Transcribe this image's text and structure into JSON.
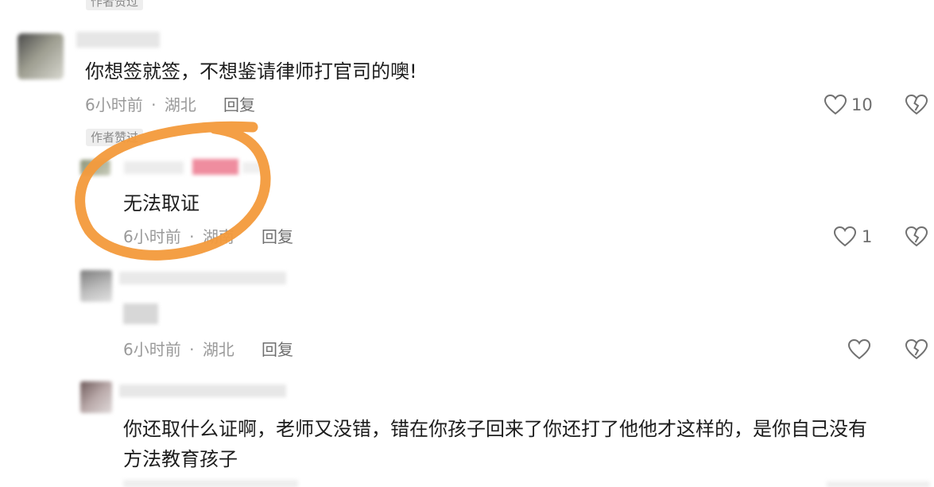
{
  "comments": [
    {
      "badge": "作者赞过",
      "text": "你想签就签，不想鉴请律师打官司的噢!",
      "time": "6小时前",
      "location": "湖北",
      "reply_label": "回复",
      "likes": "10"
    },
    {
      "badge": "作者赞过",
      "text": "无法取证",
      "time": "6小时前",
      "location": "湖南",
      "reply_label": "回复",
      "likes": "1"
    },
    {
      "time": "6小时前",
      "location": "湖北",
      "reply_label": "回复"
    },
    {
      "text_line1": "你还取什么证啊，老师又没错，错在你孩子回来了你还打了他他才这样的，是你自己没有",
      "text_line2": "方法教育孩子"
    }
  ],
  "meta_separator": "·",
  "icons": {
    "like": "heart-outline-icon",
    "dislike": "broken-heart-icon"
  },
  "colors": {
    "highlight_circle": "#f39a3b",
    "meta_text": "#9a9a9a",
    "badge_bg": "#eeeeee"
  }
}
